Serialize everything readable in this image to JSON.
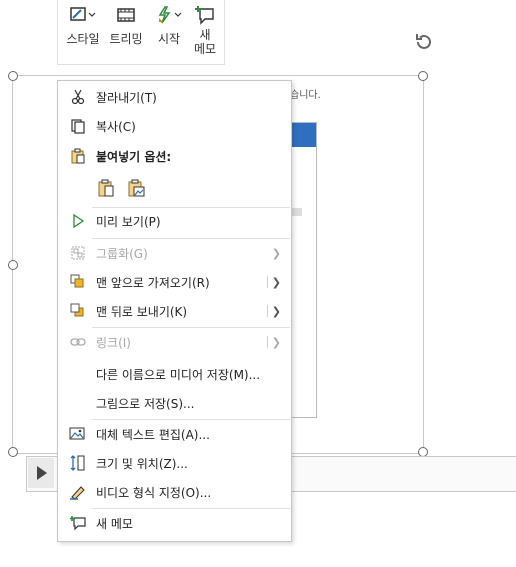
{
  "ribbon": {
    "buttons": [
      {
        "label": "스타일",
        "icon": "style-icon"
      },
      {
        "label": "트리밍",
        "icon": "trim-icon"
      },
      {
        "label": "시작",
        "icon": "start-icon"
      },
      {
        "label_line1": "새",
        "label_line2": "메모",
        "icon": "new-note-icon"
      }
    ]
  },
  "document": {
    "partial_text": "습니다."
  },
  "menu": {
    "cut": "잘라내기(T)",
    "copy": "복사(C)",
    "paste_options": "붙여넣기 옵션:",
    "preview": "미리 보기(P)",
    "group": "그룹화(G)",
    "bring_front": "맨 앞으로 가져오기(R)",
    "send_back": "맨 뒤로 보내기(K)",
    "link": "링크(I)",
    "save_media_as": "다른 이름으로 미디어 저장(M)...",
    "save_as_picture": "그림으로 저장(S)...",
    "edit_alt_text": "대체 텍스트 편집(A)...",
    "size_position": "크기 및 위치(Z)...",
    "format_video": "비디오 형식 지정(O)...",
    "new_note": "새 메모"
  }
}
